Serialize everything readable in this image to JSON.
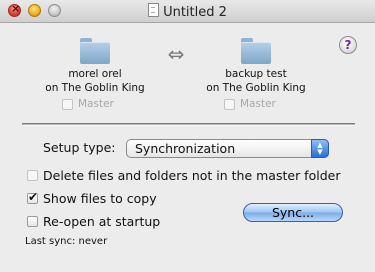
{
  "window": {
    "title": "Untitled 2"
  },
  "source": {
    "name": "morel orel",
    "host": "on The Goblin King",
    "master_label": "Master",
    "master_checked": false
  },
  "target": {
    "name": "backup test",
    "host": "on The Goblin King",
    "master_label": "Master",
    "master_checked": false
  },
  "help": {
    "label": "?"
  },
  "setup": {
    "label": "Setup type:",
    "selected": "Synchronization"
  },
  "options": {
    "delete_label": "Delete files and folders not in the master folder",
    "delete_checked": false,
    "show_files_label": "Show files to copy",
    "show_files_checked": true,
    "reopen_label": "Re-open at startup",
    "reopen_checked": false
  },
  "sync_button": {
    "label": "Sync..."
  },
  "status": {
    "last_sync": "Last sync: never"
  }
}
